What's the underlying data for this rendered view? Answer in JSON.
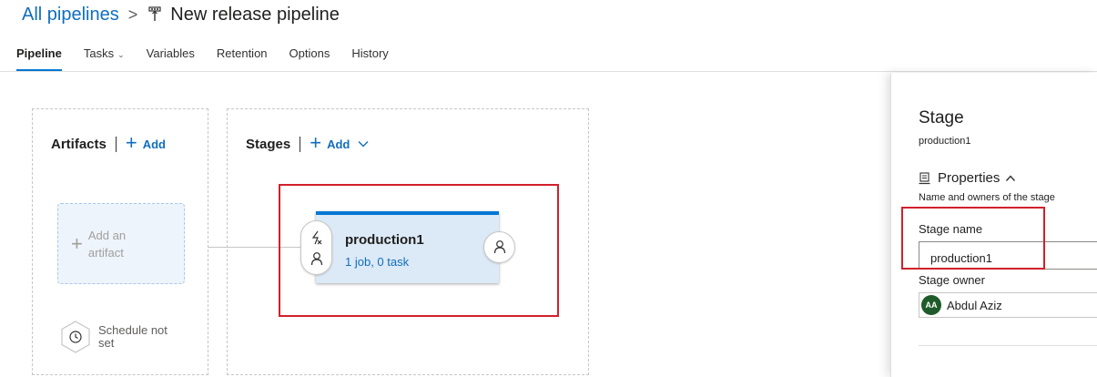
{
  "breadcrumb": {
    "root": "All pipelines",
    "separator": ">",
    "title": "New release pipeline",
    "title_icon": "release-pipeline-icon"
  },
  "tabs": [
    {
      "label": "Pipeline",
      "active": true
    },
    {
      "label": "Tasks",
      "has_dropdown": true
    },
    {
      "label": "Variables"
    },
    {
      "label": "Retention"
    },
    {
      "label": "Options"
    },
    {
      "label": "History"
    }
  ],
  "artifacts": {
    "title": "Artifacts",
    "add_label": "Add",
    "placeholder": "Add an artifact",
    "schedule": "Schedule not set"
  },
  "stages": {
    "title": "Stages",
    "add_label": "Add",
    "stage": {
      "name": "production1",
      "summary": "1 job, 0 task"
    }
  },
  "properties_panel": {
    "title": "Stage",
    "subtitle": "production1",
    "section_title": "Properties",
    "section_desc": "Name and owners of the stage",
    "stage_name_label": "Stage name",
    "stage_name_value": "production1",
    "stage_owner_label": "Stage owner",
    "owner": {
      "initials": "AA",
      "name": "Abdul Aziz"
    }
  },
  "colors": {
    "accent": "#0078d4",
    "link": "#106ebe",
    "highlight": "#d1202c",
    "avatar": "#1e5b2a"
  }
}
